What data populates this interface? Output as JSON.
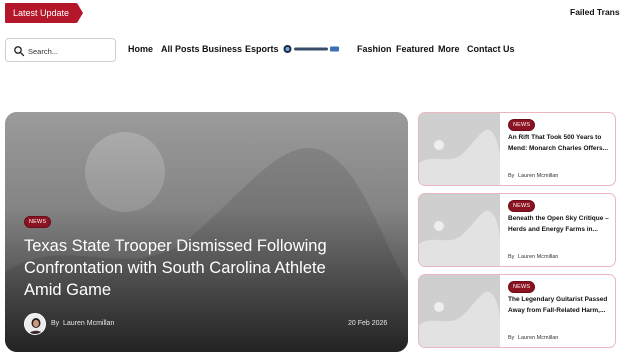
{
  "topbar": {
    "latest_label": "Latest Update",
    "ticker_text": "Failed Trans"
  },
  "search": {
    "placeholder": "Search..."
  },
  "nav": {
    "items": [
      "Home",
      "All Posts",
      "Business",
      "Esports",
      "Fashion",
      "Featured",
      "More",
      "Contact Us"
    ],
    "logo_icon": "partner-logo-icon"
  },
  "hero": {
    "badge": "NEWS",
    "title": "Texas State Trooper Dismissed Following Confrontation with South Carolina Athlete Amid Game",
    "by": "By",
    "author": "Lauren Mcmillan",
    "date": "20 Feb 2026"
  },
  "cards": [
    {
      "badge": "NEWS",
      "title": "An Rift That Took 500 Years to Mend: Monarch Charles Offers...",
      "by": "By",
      "author": "Lauren Mcmillan"
    },
    {
      "badge": "NEWS",
      "title": "Beneath the Open Sky Critique – Herds and Energy Farms in...",
      "by": "By",
      "author": "Lauren Mcmillan"
    },
    {
      "badge": "NEWS",
      "title": "The Legendary Guitarist Passed Away from Fall-Related Harm,...",
      "by": "By",
      "author": "Lauren Mcmillan"
    }
  ],
  "colors": {
    "accent": "#b4162a",
    "badge": "#8c1322",
    "card_border": "#e9b7bd",
    "placeholder_gray": "#cfcfcf"
  }
}
